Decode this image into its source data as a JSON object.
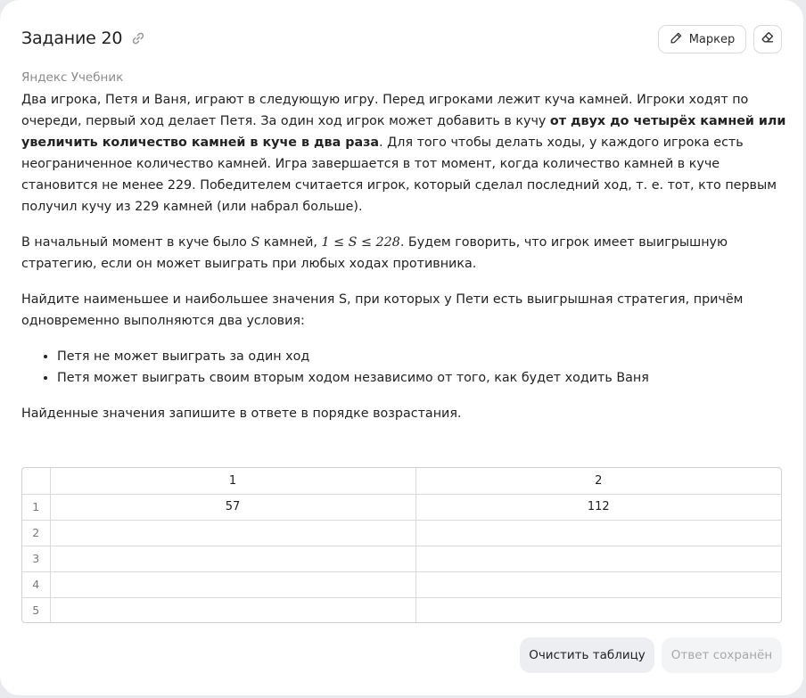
{
  "task": {
    "title": "Задание 20",
    "source": "Яндекс Учебник"
  },
  "toolbar": {
    "marker_label": "Маркер"
  },
  "problem": {
    "p1_a": "Два игрока, Петя и Ваня, играют в следующую игру. Перед игроками лежит куча камней. Игроки ходят по очереди, первый ход делает Петя. За один ход игрок может добавить в кучу ",
    "p1_bold": "от двух до четырёх камней или увеличить количество камней в куче в два раза",
    "p1_b": ". Для того чтобы делать ходы, у каждого игрока есть неограниченное количество камней. Игра завершается в тот момент, когда количество камней в куче становится не менее 229. Победителем считается игрок, который сделал последний ход, т. е. тот, кто первым получил кучу из 229 камней (или набрал больше).",
    "p2_a": "В начальный момент в куче было ",
    "p2_var": "S",
    "p2_mid": " камней, ",
    "p2_range": "1 ≤ S ≤ 228",
    "p2_b": ". Будем говорить, что игрок имеет выигрышную стратегию, если он может выиграть при любых ходах противника.",
    "p3": "Найдите наименьшее и наибольшее значения S, при которых у Пети есть выигрышная стратегия, причём одновременно выполняются два условия:",
    "conditions": [
      "Петя не может выиграть за один ход",
      "Петя может выиграть своим вторым ходом независимо от того, как будет ходить Ваня"
    ],
    "p4": "Найденные значения запишите в ответе в порядке возрастания."
  },
  "answer_table": {
    "columns": [
      "1",
      "2"
    ],
    "rows": [
      {
        "num": "1",
        "cells": [
          "57",
          "112"
        ]
      },
      {
        "num": "2",
        "cells": [
          "",
          ""
        ]
      },
      {
        "num": "3",
        "cells": [
          "",
          ""
        ]
      },
      {
        "num": "4",
        "cells": [
          "",
          ""
        ]
      },
      {
        "num": "5",
        "cells": [
          "",
          ""
        ]
      }
    ]
  },
  "actions": {
    "clear_label": "Очистить таблицу",
    "saved_label": "Ответ сохранён"
  },
  "icons": {
    "title_link": "link-icon",
    "marker": "pencil-icon",
    "eraser": "eraser-icon"
  },
  "colors": {
    "background": "#e9eaed",
    "card": "#ffffff",
    "muted_text": "#8c8c8c",
    "button_bg": "#edeef1"
  }
}
